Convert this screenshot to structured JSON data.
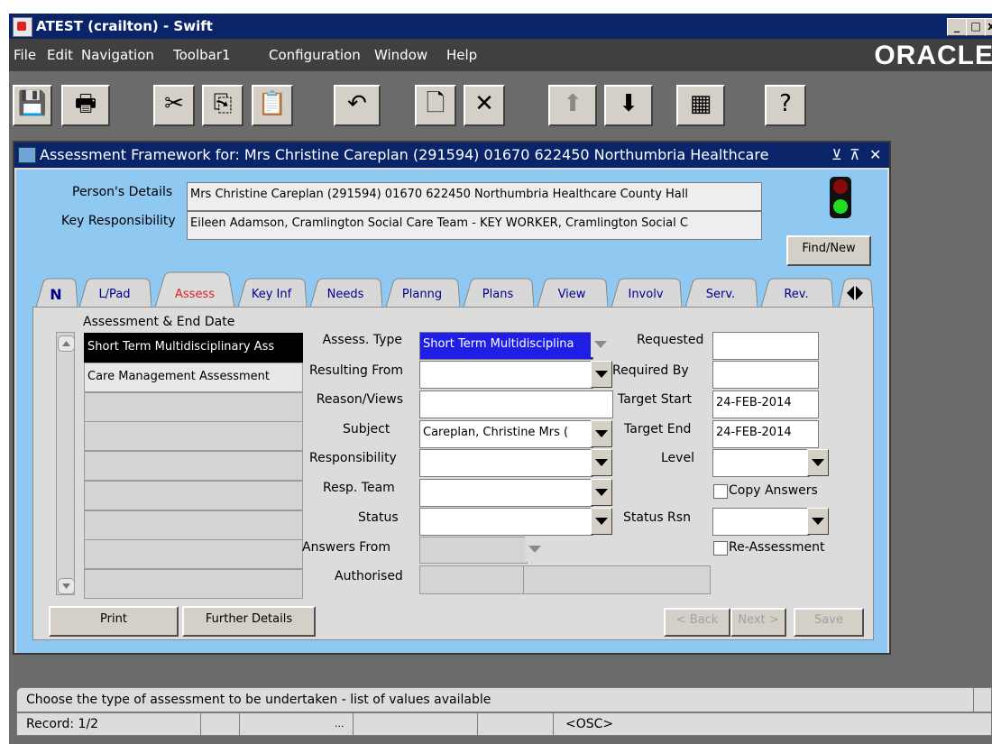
{
  "window": {
    "title": "ATEST (crailton) - Swift",
    "minimize": "_",
    "maximize": "□",
    "close": "x"
  },
  "menu": {
    "items": [
      "File",
      "Edit",
      "Navigation",
      "Toolbar1",
      "Configuration",
      "Window",
      "Help"
    ],
    "logo": "ORACLE"
  },
  "toolbar": {
    "buttons": [
      {
        "name": "save",
        "glyph": "💾"
      },
      {
        "name": "print",
        "glyph": "🖶"
      },
      {
        "name": "cut",
        "glyph": "✂"
      },
      {
        "name": "copy",
        "glyph": "⎘"
      },
      {
        "name": "paste",
        "glyph": "📋"
      },
      {
        "name": "undo",
        "glyph": "↶"
      },
      {
        "name": "new-record",
        "glyph": "🗋"
      },
      {
        "name": "delete-record",
        "glyph": "✕"
      },
      {
        "name": "previous-block",
        "glyph": "⬆"
      },
      {
        "name": "next-block",
        "glyph": "⬇"
      },
      {
        "name": "list-of-values",
        "glyph": "▦"
      },
      {
        "name": "help",
        "glyph": "?"
      }
    ]
  },
  "form": {
    "title": "Assessment Framework for:  Mrs Christine Careplan (291594) 01670 622450 Northumbria Healthcare",
    "title_controls": {
      "minimize": "⊻",
      "maximize": "⊼",
      "close": "✕"
    },
    "persons_details_label": "Person's Details",
    "persons_details_value": "Mrs Christine Careplan (291594) 01670 622450 Northumbria Healthcare County Hall",
    "key_responsibility_label": "Key Responsibility",
    "key_responsibility_value": "Eileen Adamson, Cramlington Social Care Team - KEY WORKER, Cramlington Social C",
    "find_new_button": "Find/New"
  },
  "tabs": {
    "nav_icon": "N",
    "items": [
      "L/Pad",
      "Assess",
      "Key Inf",
      "Needs",
      "Planng",
      "Plans",
      "View",
      "Involv",
      "Serv.",
      "Rev."
    ],
    "active": "Assess"
  },
  "assessment": {
    "list_header": "Assessment & End Date",
    "rows": [
      "Short Term Multidisciplinary Ass",
      "Care Management Assessment",
      "",
      "",
      "",
      "",
      "",
      "",
      ""
    ],
    "fields": {
      "assess_type_label": "Assess. Type",
      "assess_type_value": "Short Term Multidisciplina",
      "resulting_from_label": "Resulting From",
      "resulting_from_value": "",
      "reason_views_label": "Reason/Views",
      "reason_views_value": "",
      "subject_label": "Subject",
      "subject_value": "Careplan, Christine Mrs (",
      "responsibility_label": "Responsibility",
      "responsibility_value": "",
      "resp_team_label": "Resp. Team",
      "resp_team_value": "",
      "status_label": "Status",
      "status_value": "",
      "answers_from_label": "Answers From",
      "answers_from_value": "",
      "authorised_label": "Authorised",
      "authorised_value_1": "",
      "authorised_value_2": "",
      "requested_label": "Requested",
      "requested_value": "",
      "required_by_label": "Required By",
      "required_by_value": "",
      "target_start_label": "Target Start",
      "target_start_value": "24-FEB-2014",
      "target_end_label": "Target End",
      "target_end_value": "24-FEB-2014",
      "level_label": "Level",
      "level_value": "",
      "copy_answers_label": "Copy Answers",
      "status_rsn_label": "Status Rsn",
      "status_rsn_value": "",
      "re_assessment_label": "Re-Assessment"
    },
    "buttons": {
      "print": "Print",
      "further_details": "Further Details",
      "back": "< Back",
      "next": "Next >",
      "save": "Save"
    }
  },
  "statusbar": {
    "message": "Choose the type of assessment to be undertaken - list of values available",
    "record": "Record: 1/2",
    "list_indicator": "...",
    "mode": "<OSC>"
  }
}
